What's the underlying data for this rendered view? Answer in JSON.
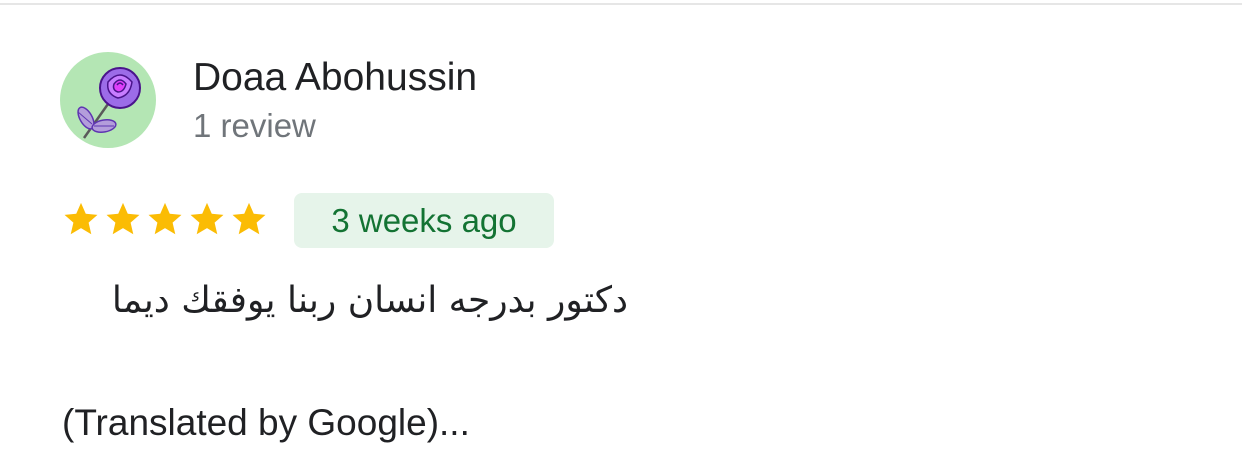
{
  "review": {
    "author_name": "Doaa Abohussin",
    "review_count": "1 review",
    "rating": 5,
    "rating_max": 5,
    "date": "3 weeks ago",
    "text": "دكتور بدرجه انسان ربنا يوفقك ديما",
    "translation_link": "(Translated by Google)..."
  },
  "colors": {
    "star": "#fbbc04",
    "badge_bg": "#e6f4ea",
    "badge_text": "#137333",
    "avatar_bg": "#b4e6b4"
  },
  "icons": {
    "avatar": "rose-icon",
    "star": "star-icon"
  }
}
